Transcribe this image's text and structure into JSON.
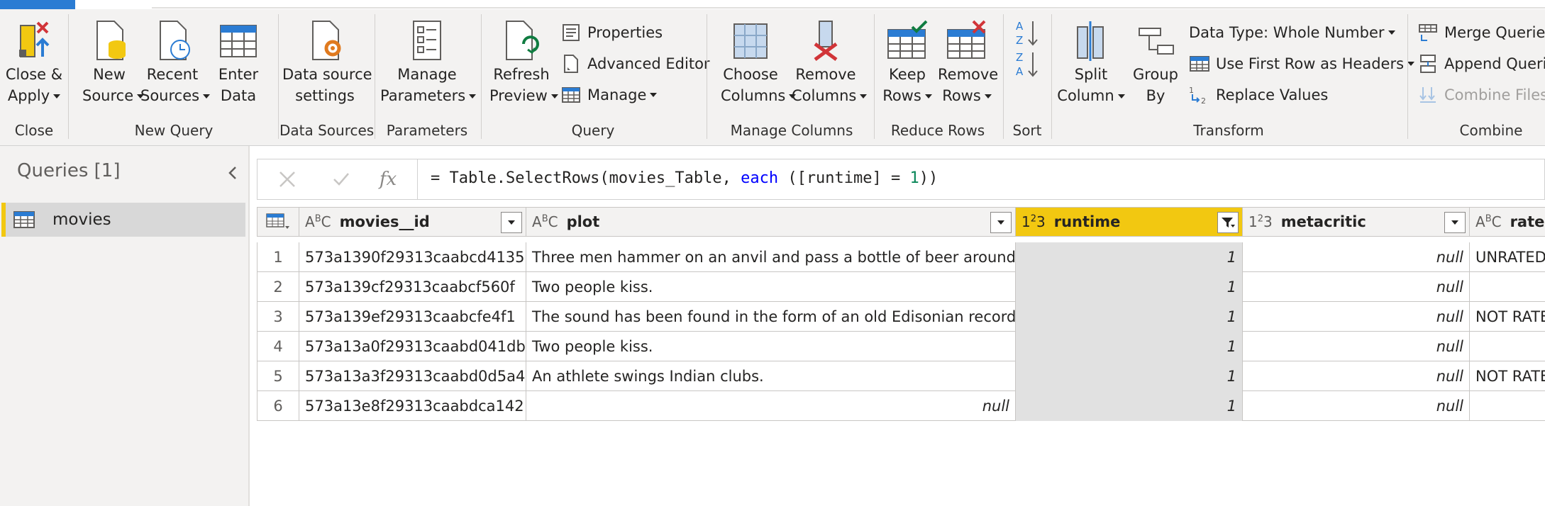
{
  "ribbon": {
    "groups": {
      "close": "Close",
      "new_query": "New Query",
      "data_sources": "Data Sources",
      "parameters": "Parameters",
      "query": "Query",
      "manage_columns": "Manage Columns",
      "reduce_rows": "Reduce Rows",
      "sort": "Sort",
      "transform": "Transform",
      "combine": "Combine"
    },
    "close_apply": [
      "Close &",
      "Apply"
    ],
    "new_source": [
      "New",
      "Source"
    ],
    "recent_sources": [
      "Recent",
      "Sources"
    ],
    "enter_data": [
      "Enter",
      "Data"
    ],
    "data_source_settings": [
      "Data source",
      "settings"
    ],
    "manage_parameters": [
      "Manage",
      "Parameters"
    ],
    "refresh_preview": [
      "Refresh",
      "Preview"
    ],
    "properties": "Properties",
    "advanced_editor": "Advanced Editor",
    "manage": "Manage",
    "choose_columns": [
      "Choose",
      "Columns"
    ],
    "remove_columns": [
      "Remove",
      "Columns"
    ],
    "keep_rows": [
      "Keep",
      "Rows"
    ],
    "remove_rows": [
      "Remove",
      "Rows"
    ],
    "split_column": [
      "Split",
      "Column"
    ],
    "group_by": [
      "Group",
      "By"
    ],
    "data_type": "Data Type: Whole Number",
    "use_first_row": "Use First Row as Headers",
    "replace_values": "Replace Values",
    "merge_queries": "Merge Queries",
    "append_queries": "Append Querie",
    "combine_files": "Combine Files"
  },
  "queries": {
    "title": "Queries [1]",
    "items": [
      {
        "label": "movies"
      }
    ]
  },
  "formula": {
    "prefix": "= Table.SelectRows(movies_Table, ",
    "keyword": "each",
    "middle": " ([runtime] = ",
    "number": "1",
    "suffix": "))"
  },
  "table": {
    "columns": [
      {
        "type": "ABC",
        "name": "movies__id"
      },
      {
        "type": "ABC",
        "name": "plot"
      },
      {
        "type": "123",
        "name": "runtime"
      },
      {
        "type": "123",
        "name": "metacritic"
      },
      {
        "type": "ABC",
        "name": "rated"
      }
    ],
    "rows": [
      {
        "n": "1",
        "id": "573a1390f29313caabcd4135",
        "plot": "Three men hammer on an anvil and pass a bottle of beer around.",
        "runtime": "1",
        "metacritic": "null",
        "rated": "UNRATED"
      },
      {
        "n": "2",
        "id": "573a139cf29313caabcf560f",
        "plot": "Two people kiss.",
        "runtime": "1",
        "metacritic": "null",
        "rated": ""
      },
      {
        "n": "3",
        "id": "573a139ef29313caabcfe4f1",
        "plot": "The sound has been found in the form of an old Edisonian recordin...",
        "runtime": "1",
        "metacritic": "null",
        "rated": "NOT RATE"
      },
      {
        "n": "4",
        "id": "573a13a0f29313caabd041db",
        "plot": "Two people kiss.",
        "runtime": "1",
        "metacritic": "null",
        "rated": ""
      },
      {
        "n": "5",
        "id": "573a13a3f29313caabd0d5a4",
        "plot": "An athlete swings Indian clubs.",
        "runtime": "1",
        "metacritic": "null",
        "rated": "NOT RATE"
      },
      {
        "n": "6",
        "id": "573a13e8f29313caabdca142",
        "plot": "null",
        "runtime": "1",
        "metacritic": "null",
        "rated": ""
      }
    ]
  },
  "colors": {
    "accent_yellow": "#f2c811",
    "ribbon_blue": "#2b7cd3",
    "red": "#d13438",
    "green": "#107c41"
  }
}
